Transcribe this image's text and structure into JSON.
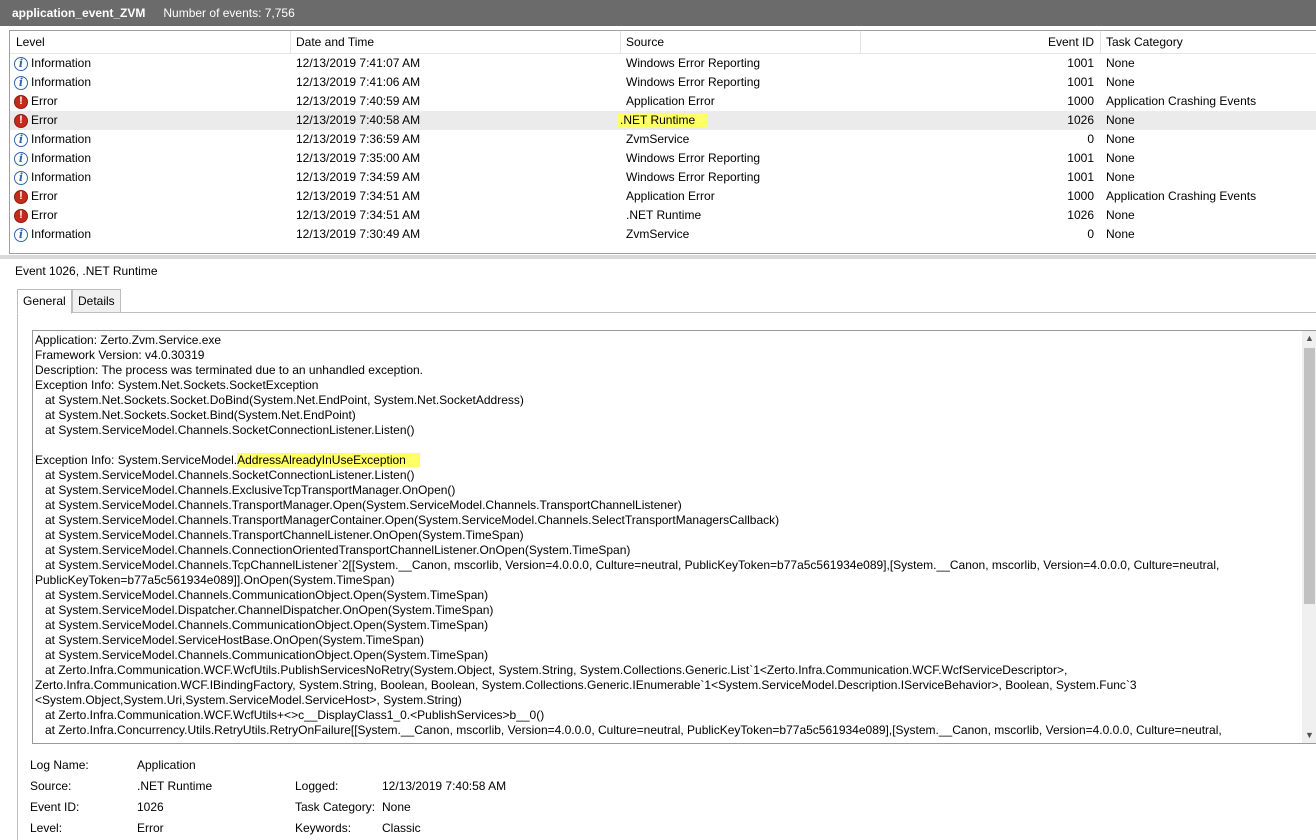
{
  "window": {
    "title": "application_event_ZVM",
    "event_count": "Number of events: 7,756"
  },
  "columns": [
    "Level",
    "Date and Time",
    "Source",
    "Event ID",
    "Task Category"
  ],
  "rows": [
    {
      "level": "Information",
      "icon": "info-icon",
      "datetime": "12/13/2019 7:41:07 AM",
      "source": "Windows Error Reporting",
      "event_id": "1001",
      "task_category": "None"
    },
    {
      "level": "Information",
      "icon": "info-icon",
      "datetime": "12/13/2019 7:41:06 AM",
      "source": "Windows Error Reporting",
      "event_id": "1001",
      "task_category": "None"
    },
    {
      "level": "Error",
      "icon": "error-icon",
      "datetime": "12/13/2019 7:40:59 AM",
      "source": "Application Error",
      "event_id": "1000",
      "task_category": "Application Crashing Events"
    },
    {
      "level": "Error",
      "icon": "error-icon",
      "datetime": "12/13/2019 7:40:58 AM",
      "source": ".NET Runtime",
      "event_id": "1026",
      "task_category": "None"
    },
    {
      "level": "Information",
      "icon": "info-icon",
      "datetime": "12/13/2019 7:36:59 AM",
      "source": "ZvmService",
      "event_id": "0",
      "task_category": "None"
    },
    {
      "level": "Information",
      "icon": "info-icon",
      "datetime": "12/13/2019 7:35:00 AM",
      "source": "Windows Error Reporting",
      "event_id": "1001",
      "task_category": "None"
    },
    {
      "level": "Information",
      "icon": "info-icon",
      "datetime": "12/13/2019 7:34:59 AM",
      "source": "Windows Error Reporting",
      "event_id": "1001",
      "task_category": "None"
    },
    {
      "level": "Error",
      "icon": "error-icon",
      "datetime": "12/13/2019 7:34:51 AM",
      "source": "Application Error",
      "event_id": "1000",
      "task_category": "Application Crashing Events"
    },
    {
      "level": "Error",
      "icon": "error-icon",
      "datetime": "12/13/2019 7:34:51 AM",
      "source": ".NET Runtime",
      "event_id": "1026",
      "task_category": "None"
    },
    {
      "level": "Information",
      "icon": "info-icon",
      "datetime": "12/13/2019 7:30:49 AM",
      "source": "ZvmService",
      "event_id": "0",
      "task_category": "None"
    }
  ],
  "selected_row": 3,
  "highlight_color": "#ffff66",
  "event_title": "Event 1026, .NET Runtime",
  "tabs": [
    "General",
    "Details"
  ],
  "event_text": {
    "before_highlight": "Application: Zerto.Zvm.Service.exe\nFramework Version: v4.0.30319\nDescription: The process was terminated due to an unhandled exception.\nException Info: System.Net.Sockets.SocketException\n   at System.Net.Sockets.Socket.DoBind(System.Net.EndPoint, System.Net.SocketAddress)\n   at System.Net.Sockets.Socket.Bind(System.Net.EndPoint)\n   at System.ServiceModel.Channels.SocketConnectionListener.Listen()\n\nException Info: System.ServiceModel.",
    "highlight": "AddressAlreadyInUseException",
    "after_highlight": "\n   at System.ServiceModel.Channels.SocketConnectionListener.Listen()\n   at System.ServiceModel.Channels.ExclusiveTcpTransportManager.OnOpen()\n   at System.ServiceModel.Channels.TransportManager.Open(System.ServiceModel.Channels.TransportChannelListener)\n   at System.ServiceModel.Channels.TransportManagerContainer.Open(System.ServiceModel.Channels.SelectTransportManagersCallback)\n   at System.ServiceModel.Channels.TransportChannelListener.OnOpen(System.TimeSpan)\n   at System.ServiceModel.Channels.ConnectionOrientedTransportChannelListener.OnOpen(System.TimeSpan)\n   at System.ServiceModel.Channels.TcpChannelListener`2[[System.__Canon, mscorlib, Version=4.0.0.0, Culture=neutral, PublicKeyToken=b77a5c561934e089],[System.__Canon, mscorlib, Version=4.0.0.0, Culture=neutral,\nPublicKeyToken=b77a5c561934e089]].OnOpen(System.TimeSpan)\n   at System.ServiceModel.Channels.CommunicationObject.Open(System.TimeSpan)\n   at System.ServiceModel.Dispatcher.ChannelDispatcher.OnOpen(System.TimeSpan)\n   at System.ServiceModel.Channels.CommunicationObject.Open(System.TimeSpan)\n   at System.ServiceModel.ServiceHostBase.OnOpen(System.TimeSpan)\n   at System.ServiceModel.Channels.CommunicationObject.Open(System.TimeSpan)\n   at Zerto.Infra.Communication.WCF.WcfUtils.PublishServicesNoRetry(System.Object, System.String, System.Collections.Generic.List`1<Zerto.Infra.Communication.WCF.WcfServiceDescriptor>,\nZerto.Infra.Communication.WCF.IBindingFactory, System.String, Boolean, Boolean, System.Collections.Generic.IEnumerable`1<System.ServiceModel.Description.IServiceBehavior>, Boolean, System.Func`3\n<System.Object,System.Uri,System.ServiceModel.ServiceHost>, System.String)\n   at Zerto.Infra.Communication.WCF.WcfUtils+<>c__DisplayClass1_0.<PublishServices>b__0()\n   at Zerto.Infra.Concurrency.Utils.RetryUtils.RetryOnFailure[[System.__Canon, mscorlib, Version=4.0.0.0, Culture=neutral, PublicKeyToken=b77a5c561934e089],[System.__Canon, mscorlib, Version=4.0.0.0, Culture=neutral,"
  },
  "properties": {
    "log_name_label": "Log Name:",
    "log_name": "Application",
    "source_label": "Source:",
    "source": ".NET Runtime",
    "logged_label": "Logged:",
    "logged": "12/13/2019 7:40:58 AM",
    "event_id_label": "Event ID:",
    "event_id": "1026",
    "task_category_label": "Task Category:",
    "task_category": "None",
    "level_label": "Level:",
    "level": "Error",
    "keywords_label": "Keywords:",
    "keywords": "Classic"
  }
}
